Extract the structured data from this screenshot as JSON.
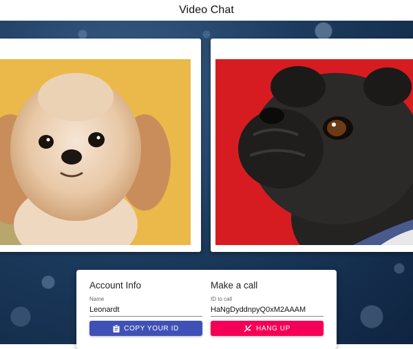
{
  "app": {
    "title": "Video Chat"
  },
  "account": {
    "heading": "Account Info",
    "name_label": "Name",
    "name_value": "Leonardt",
    "copy_button_label": "COPY YOUR ID",
    "copy_icon": "clipboard-icon"
  },
  "call": {
    "heading": "Make a call",
    "id_label": "ID to call",
    "id_value": "HaNgDyddnpyQ0xM2AAAM",
    "hangup_button_label": "HANG UP",
    "hangup_icon": "phone-disabled-icon"
  },
  "colors": {
    "primary": "#3f51b5",
    "secondary": "#f50057"
  }
}
